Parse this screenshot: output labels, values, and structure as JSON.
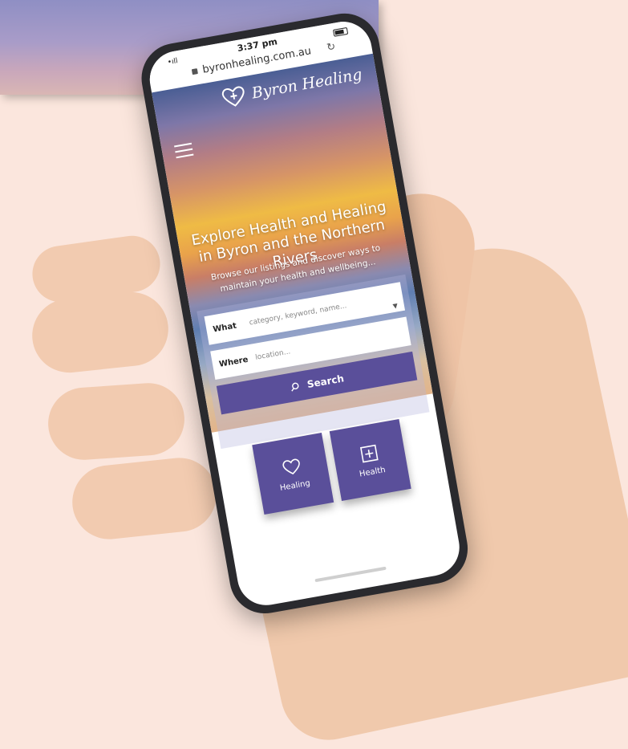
{
  "status_bar": {
    "time": "3:37 pm",
    "signal": "•ıll"
  },
  "browser": {
    "url": "byronhealing.com.au",
    "reload_icon": "reload-icon",
    "lock_icon": "lock-icon"
  },
  "site": {
    "logo_text": "Byron Healing",
    "menu_icon": "hamburger-menu-icon",
    "hero_title": "Explore Health and Healing in Byron and the Northern Rivers",
    "hero_subtitle": "Browse our listings and discover ways to maintain your health and wellbeing...",
    "search": {
      "what_label": "What",
      "what_placeholder": "category, keyword, name...",
      "where_label": "Where",
      "where_placeholder": "location...",
      "button_label": "Search"
    },
    "tiles": [
      {
        "label": "Healing",
        "icon": "heart-icon"
      },
      {
        "label": "Health",
        "icon": "plus-square-icon"
      }
    ]
  },
  "colors": {
    "page_background": "#fbe6dd",
    "accent_purple": "#5a4f9a",
    "phone_frame": "#2a2a2e"
  }
}
